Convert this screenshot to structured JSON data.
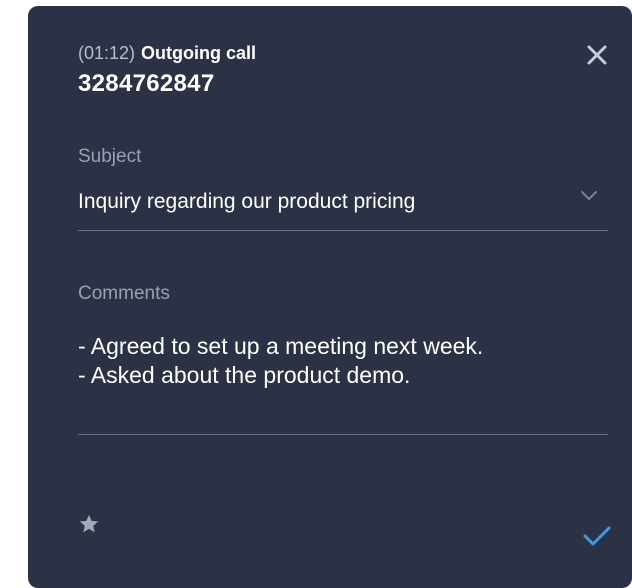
{
  "call": {
    "timer": "(01:12)",
    "type": "Outgoing call",
    "phone": "3284762847"
  },
  "subject": {
    "label": "Subject",
    "value": "Inquiry regarding our product pricing"
  },
  "comments": {
    "label": "Comments",
    "lines": [
      "- Agreed to set up a meeting next week.",
      "- Asked about the product demo."
    ]
  },
  "icons": {
    "close": "close-icon",
    "chevron": "chevron-down-icon",
    "star": "star-icon",
    "confirm": "checkmark-icon"
  },
  "colors": {
    "panel_bg": "#2c3245",
    "accent": "#3f9be3",
    "text_primary": "#ffffff",
    "text_muted": "#9aa0b0"
  }
}
